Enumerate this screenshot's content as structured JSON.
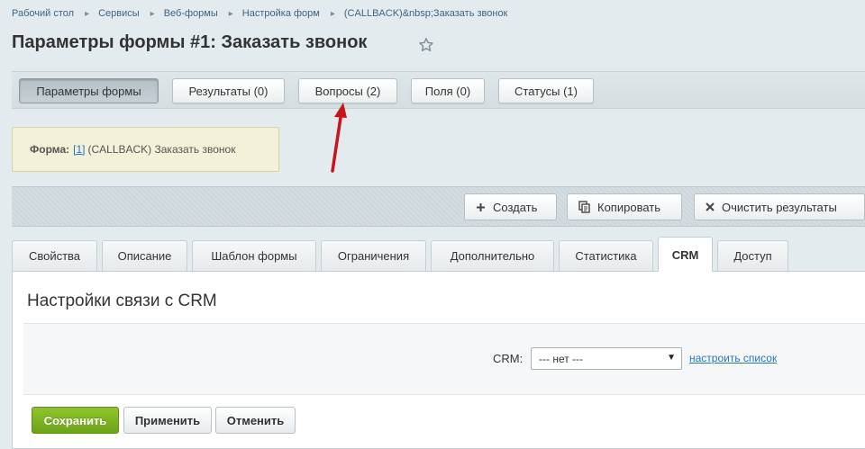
{
  "breadcrumb": [
    "Рабочий стол",
    "Сервисы",
    "Веб-формы",
    "Настройка форм",
    "(CALLBACK)&nbsp;Заказать звонок"
  ],
  "breadcrumb_separator": "▸",
  "page_title": "Параметры формы #1: Заказать звонок",
  "context_tabs": [
    {
      "label": "Параметры формы",
      "active": true
    },
    {
      "label": "Результаты (0)",
      "active": false
    },
    {
      "label": "Вопросы (2)",
      "active": false
    },
    {
      "label": "Поля (0)",
      "active": false
    },
    {
      "label": "Статусы (1)",
      "active": false
    }
  ],
  "form_info": {
    "label": "Форма:",
    "id_link": "[1]",
    "name": "(CALLBACK) Заказать звонок"
  },
  "actions": {
    "create": "Создать",
    "copy": "Копировать",
    "clear_results": "Очистить результаты"
  },
  "tabs": [
    {
      "label": "Свойства",
      "active": false
    },
    {
      "label": "Описание",
      "active": false
    },
    {
      "label": "Шаблон формы",
      "active": false
    },
    {
      "label": "Ограничения",
      "active": false
    },
    {
      "label": "Дополнительно",
      "active": false
    },
    {
      "label": "Статистика",
      "active": false
    },
    {
      "label": "CRM",
      "active": true
    },
    {
      "label": "Доступ",
      "active": false
    }
  ],
  "crm_section": {
    "title": "Настройки связи с CRM",
    "crm_label": "CRM:",
    "crm_selected": "--- нет ---",
    "configure_link": "настроить список"
  },
  "footer": {
    "save": "Сохранить",
    "apply": "Применить",
    "cancel": "Отменить"
  },
  "colors": {
    "accent_link": "#2675c4",
    "save_button": "#7cb521",
    "annotation_arrow": "#c8141b"
  }
}
